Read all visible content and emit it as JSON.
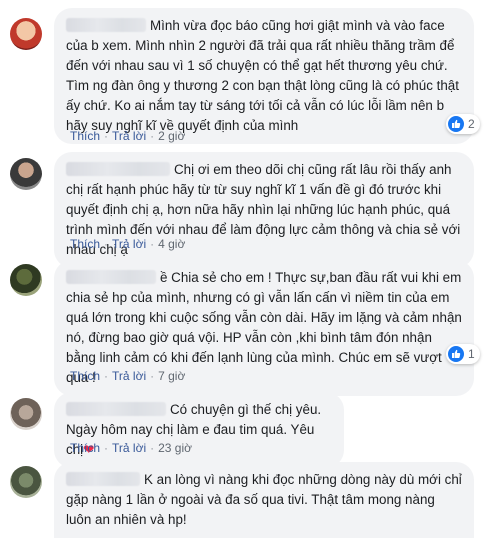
{
  "comments": [
    {
      "text": "Mình vừa đọc báo cũng hơi giật mình và vào face của b xem. Mình nhìn 2 người đã trải qua rất nhiều thăng trầm để đến với nhau sau vì 1 số chuyện có thể gạt hết thương yêu chứ. Tìm ng đàn ông y thương 2 con bạn thật lòng cũng là có phúc thật ấy chứ. Ko ai nắm tay từ sáng tới tối cả vẫn có lúc lỗi lầm nên b hãy suy nghĩ kĩ về quyết định của mình",
      "like_label": "Thích",
      "reply_label": "Trả lời",
      "time": "2 giờ",
      "reaction_count": "2"
    },
    {
      "text": "Chị ơi em theo dõi chị cũng rất lâu rồi thấy anh chị rất hạnh phúc hãy từ từ suy nghĩ kĩ 1 vấn đề gì đó trước khi quyết định chị ạ, hơn nữa hãy nhìn lại những lúc hạnh phúc, quá trình mình đến với nhau để làm động lực cảm thông và chia sẻ với nhau chị ạ",
      "like_label": "Thích",
      "reply_label": "Trả lời",
      "time": "4 giờ"
    },
    {
      "text": "ề Chia sẻ cho em ! Thực sự,ban đầu rất vui khi em chia sẻ hp của mình, nhưng có gì vẫn lấn cấn vì niềm tin của em quá lớn trong khi cuộc sống vẫn còn dài. Hãy im lặng và cảm nhận nó, đừng bao giờ quá vội. HP vẫn còn ,khi bình tâm đón nhận bằng linh cảm có khi đến lạnh lùng của mình. Chúc em sẽ vượt qua !",
      "like_label": "Thích",
      "reply_label": "Trả lời",
      "time": "7 giờ",
      "reaction_count": "1"
    },
    {
      "text": "Có chuyện gì thế chị yêu. Ngày hôm nay chị làm e đau tim quá. Yêu chị",
      "like_label": "Thích",
      "reply_label": "Trả lời",
      "time": "23 giờ"
    },
    {
      "text": "K an lòng vì nàng khi đọc những dòng này dù mới chỉ gặp nàng 1 lần ở ngoài và đa số qua tivi. Thật tâm mong nàng luôn an nhiên và hp!"
    }
  ]
}
